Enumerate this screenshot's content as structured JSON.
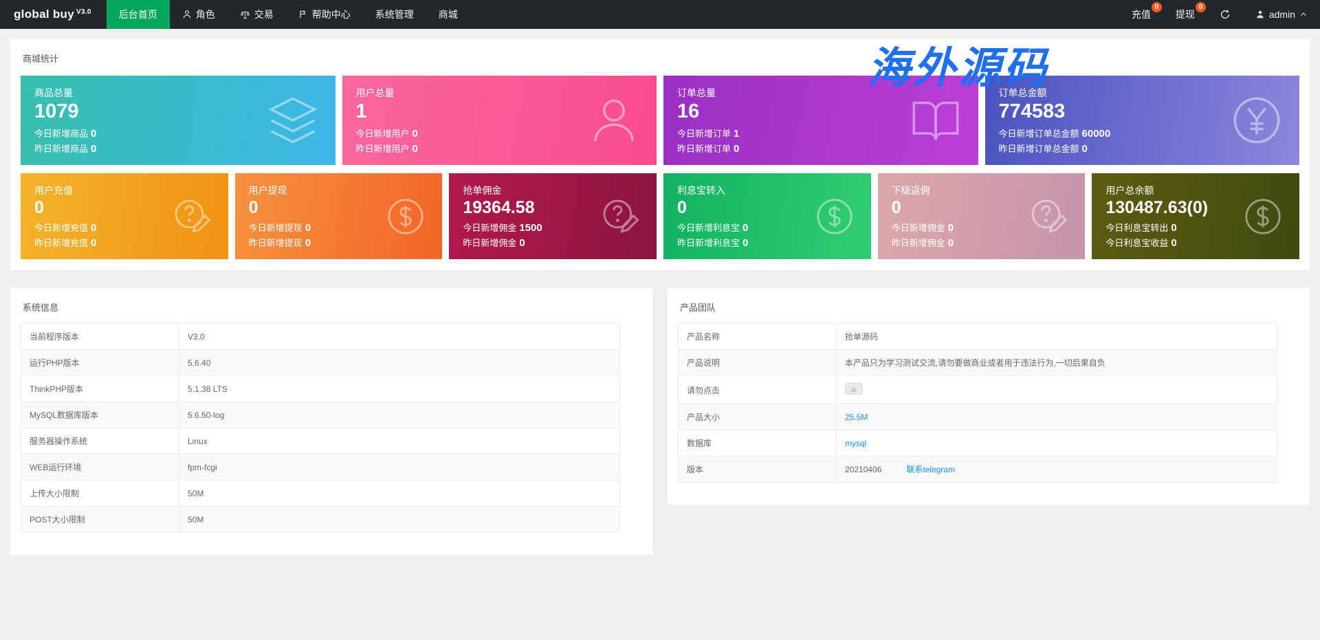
{
  "colors": {
    "accent_green": "#00a65a",
    "badge": "#ff5722",
    "link": "#1890ff",
    "navbar_bg": "#23262b"
  },
  "navbar": {
    "brand": "global buy",
    "version": "V3.0",
    "items": [
      {
        "label": "后台首页"
      },
      {
        "label": "角色"
      },
      {
        "label": "交易"
      },
      {
        "label": "帮助中心"
      },
      {
        "label": "系统管理"
      },
      {
        "label": "商城"
      }
    ],
    "recharge": {
      "label": "充值",
      "badge": "0"
    },
    "withdraw": {
      "label": "提现",
      "badge": "0"
    },
    "admin": {
      "label": "admin"
    }
  },
  "watermark": {
    "text": "海外源码",
    "color": "#1f6ff0"
  },
  "stats": {
    "title": "商城统计",
    "cards_large": [
      {
        "title": "商品总量",
        "value": "1079",
        "line1_label": "今日新增商品",
        "line1_value": "0",
        "line2_label": "昨日新增商品",
        "line2_value": "0",
        "icon": "layers-icon",
        "gradient_from": "#38bfae",
        "gradient_to": "#3eb6e8"
      },
      {
        "title": "用户总量",
        "value": "1",
        "line1_label": "今日新增用户",
        "line1_value": "0",
        "line2_label": "昨日新增用户",
        "line2_value": "0",
        "icon": "user-icon",
        "gradient_from": "#f9689c",
        "gradient_to": "#fa4b90"
      },
      {
        "title": "订单总量",
        "value": "16",
        "line1_label": "今日新增订单",
        "line1_value": "1",
        "line2_label": "昨日新增订单",
        "line2_value": "0",
        "icon": "book-icon",
        "gradient_from": "#9a2fc4",
        "gradient_to": "#bb3fd8"
      },
      {
        "title": "订单总金额",
        "value": "774583",
        "line1_label": "今日新增订单总金额",
        "line1_value": "60000",
        "line2_label": "昨日新增订单总金额",
        "line2_value": "0",
        "icon": "yen-icon",
        "gradient_from": "#4a53c0",
        "gradient_to": "#8d86dc"
      }
    ],
    "cards_small": [
      {
        "title": "用户充值",
        "value": "0",
        "line1_label": "今日新增充值",
        "line1_value": "0",
        "line2_label": "昨日新增充值",
        "line2_value": "0",
        "icon": "pen-question-icon",
        "gradient_from": "#f3b42c",
        "gradient_to": "#f29111"
      },
      {
        "title": "用户提现",
        "value": "0",
        "line1_label": "今日新增提现",
        "line1_value": "0",
        "line2_label": "昨日新增提现",
        "line2_value": "0",
        "icon": "dollar-icon",
        "gradient_from": "#f7913f",
        "gradient_to": "#f26527"
      },
      {
        "title": "抢单佣金",
        "value": "19364.58",
        "line1_label": "今日新增佣金",
        "line1_value": "1500",
        "line2_label": "昨日新增佣金",
        "line2_value": "0",
        "icon": "pen-question-icon",
        "gradient_from": "#b2194e",
        "gradient_to": "#8c1440"
      },
      {
        "title": "利息宝转入",
        "value": "0",
        "line1_label": "今日新增利息宝",
        "line1_value": "0",
        "line2_label": "昨日新增利息宝",
        "line2_value": "0",
        "icon": "dollar-icon",
        "gradient_from": "#11b261",
        "gradient_to": "#33cd73"
      },
      {
        "title": "下级返佣",
        "value": "0",
        "line1_label": "今日新增佣金",
        "line1_value": "0",
        "line2_label": "昨日新增佣金",
        "line2_value": "0",
        "icon": "pen-question-icon",
        "gradient_from": "#dba8aa",
        "gradient_to": "#c693ac"
      },
      {
        "title": "用户总余额",
        "value": "130487.63(0)",
        "line1_label": "今日利息宝转出",
        "line1_value": "0",
        "line2_label": "今日利息宝收益",
        "line2_value": "0",
        "icon": "dollar-icon",
        "gradient_from": "#5c5c12",
        "gradient_to": "#3f4a0e"
      }
    ]
  },
  "system_info": {
    "title": "系统信息",
    "rows": [
      {
        "label": "当前程序版本",
        "value": "V3.0"
      },
      {
        "label": "运行PHP版本",
        "value": "5.6.40"
      },
      {
        "label": "ThinkPHP版本",
        "value": "5.1.38 LTS"
      },
      {
        "label": "MySQL数据库版本",
        "value": "5.6.50-log"
      },
      {
        "label": "服务器操作系统",
        "value": "Linux"
      },
      {
        "label": "WEB运行环境",
        "value": "fpm-fcgi"
      },
      {
        "label": "上传大小限制",
        "value": "50M"
      },
      {
        "label": "POST大小限制",
        "value": "50M"
      }
    ]
  },
  "product_team": {
    "title": "产品团队",
    "rows": [
      {
        "label": "产品名称",
        "value": "抢单源码"
      },
      {
        "label": "产品说明",
        "value": "本产品只为学习测试交流,请勿要做商业或者用于违法行为,一切后果自负"
      },
      {
        "label": "请勿点击",
        "value": ""
      },
      {
        "label": "产品大小",
        "value": "25.5M"
      },
      {
        "label": "数据库",
        "value": "mysql"
      },
      {
        "label": "版本",
        "value": "20210406",
        "link_text": "联系telegram"
      }
    ]
  }
}
